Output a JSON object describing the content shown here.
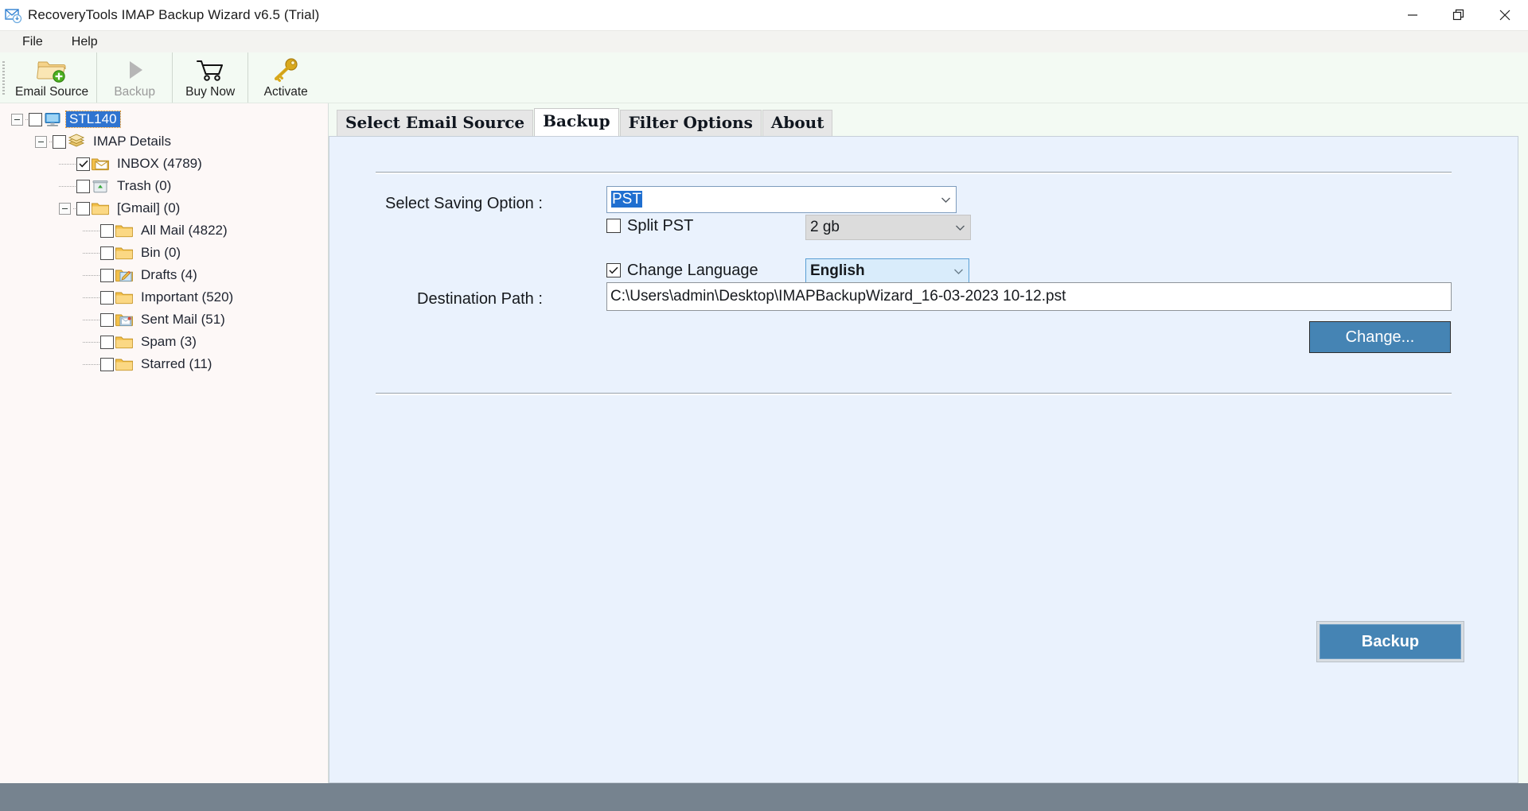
{
  "window": {
    "title": "RecoveryTools IMAP Backup Wizard v6.5 (Trial)",
    "icon": "mail-download-icon",
    "controls": {
      "minimize": "minimize-icon",
      "restore": "restore-icon",
      "close": "close-icon"
    }
  },
  "menubar": {
    "items": [
      {
        "label": "File"
      },
      {
        "label": "Help"
      }
    ]
  },
  "toolbar": {
    "buttons": [
      {
        "label": "Email Source",
        "icon": "folder-add-icon",
        "enabled": true
      },
      {
        "label": "Backup",
        "icon": "play-triangle-icon",
        "enabled": false
      },
      {
        "label": "Buy Now",
        "icon": "shopping-cart-icon",
        "enabled": true
      },
      {
        "label": "Activate",
        "icon": "key-icon",
        "enabled": true
      }
    ]
  },
  "tree": {
    "nodes": [
      {
        "label": "STL140",
        "icon": "computer-icon",
        "depth": 0,
        "expander": "collapse",
        "checked": false,
        "selected": true
      },
      {
        "label": "IMAP Details",
        "icon": "server-stack-icon",
        "depth": 1,
        "expander": "collapse",
        "checked": false,
        "selected": false
      },
      {
        "label": "INBOX (4789)",
        "icon": "inbox-mail-folder-icon",
        "depth": 2,
        "expander": "none",
        "checked": true,
        "selected": false
      },
      {
        "label": "Trash (0)",
        "icon": "trash-folder-icon",
        "depth": 2,
        "expander": "none",
        "checked": false,
        "selected": false
      },
      {
        "label": "[Gmail] (0)",
        "icon": "folder-icon",
        "depth": 2,
        "expander": "collapse",
        "checked": false,
        "selected": false
      },
      {
        "label": "All Mail (4822)",
        "icon": "folder-icon",
        "depth": 3,
        "expander": "none",
        "checked": false,
        "selected": false
      },
      {
        "label": "Bin (0)",
        "icon": "folder-icon",
        "depth": 3,
        "expander": "none",
        "checked": false,
        "selected": false
      },
      {
        "label": "Drafts (4)",
        "icon": "drafts-folder-icon",
        "depth": 3,
        "expander": "none",
        "checked": false,
        "selected": false
      },
      {
        "label": "Important (520)",
        "icon": "folder-icon",
        "depth": 3,
        "expander": "none",
        "checked": false,
        "selected": false
      },
      {
        "label": "Sent Mail (51)",
        "icon": "sent-mail-folder-icon",
        "depth": 3,
        "expander": "none",
        "checked": false,
        "selected": false
      },
      {
        "label": "Spam (3)",
        "icon": "folder-icon",
        "depth": 3,
        "expander": "none",
        "checked": false,
        "selected": false
      },
      {
        "label": "Starred (11)",
        "icon": "folder-icon",
        "depth": 3,
        "expander": "none",
        "checked": false,
        "selected": false
      }
    ]
  },
  "tabs": [
    {
      "label": "Select Email Source",
      "active": false
    },
    {
      "label": "Backup",
      "active": true
    },
    {
      "label": "Filter Options",
      "active": false
    },
    {
      "label": "About",
      "active": false
    }
  ],
  "backup_pane": {
    "saving_option_label": "Select Saving Option :",
    "saving_option_value": "PST",
    "split_checkbox_label": "Split PST",
    "split_checked": false,
    "split_size_value": "2 gb",
    "change_language_label": "Change Language",
    "change_language_checked": true,
    "language_value": "English",
    "destination_path_label": "Destination Path :",
    "destination_path_value": "C:\\Users\\admin\\Desktop\\IMAPBackupWizard_16-03-2023 10-12.pst",
    "change_button_label": "Change...",
    "backup_button_label": "Backup"
  },
  "colors": {
    "accent_blue": "#4584b4",
    "selection_blue": "#2f74d0",
    "pane_bg": "#eaf2fd",
    "tree_bg": "#fdf8f7",
    "toolbar_bg": "#f3faf3",
    "statusbar": "#76838f"
  }
}
